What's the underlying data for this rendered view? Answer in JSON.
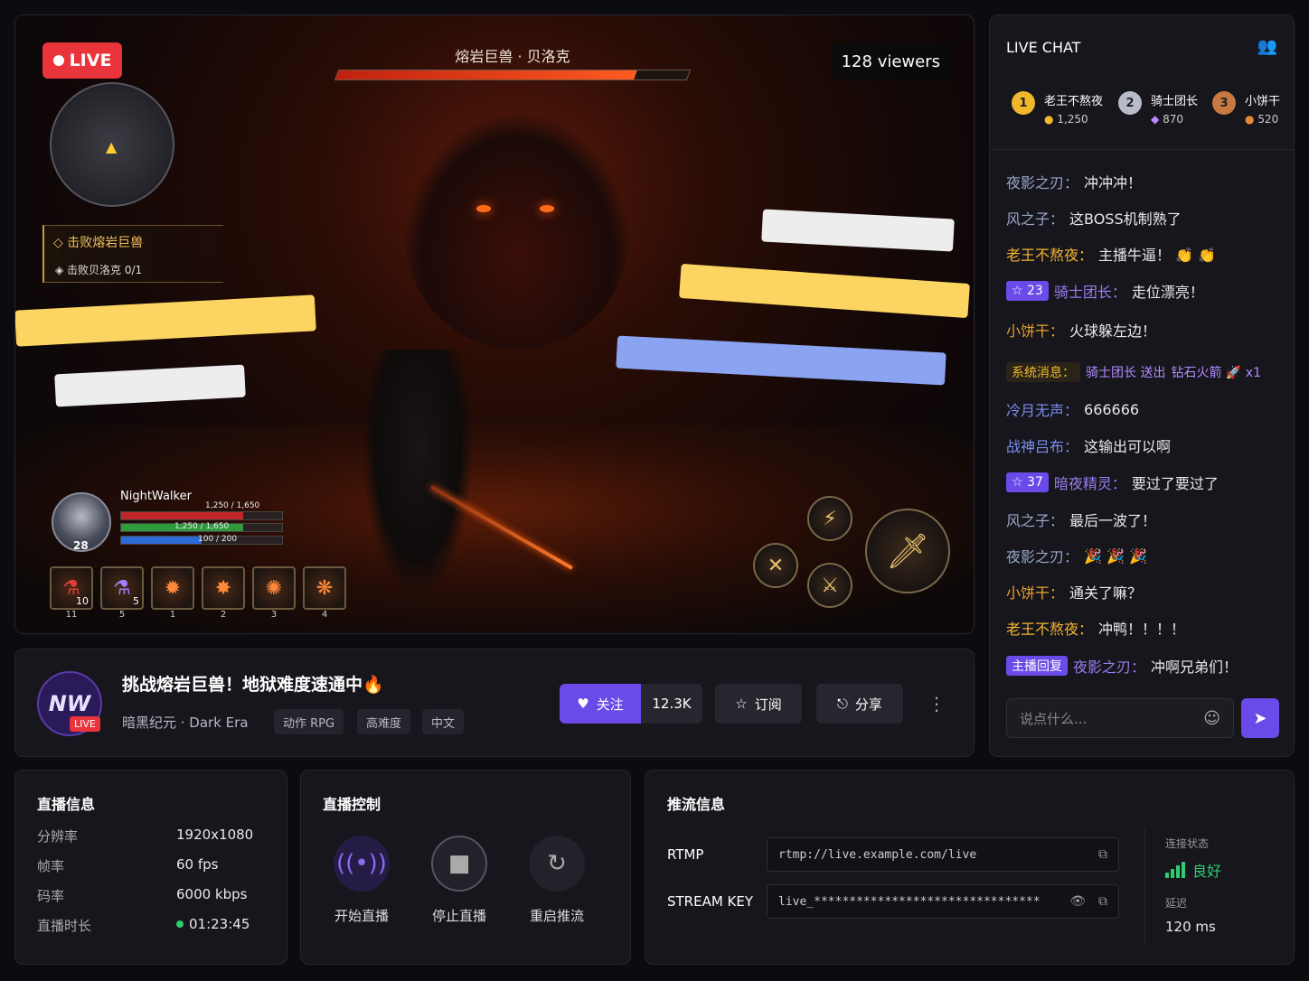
{
  "video": {
    "live_label": "LIVE",
    "viewers": "128 viewers",
    "boss_name": "熔岩巨兽 · 贝洛克",
    "boss_health_percent": 85,
    "quest": {
      "title": "击败熔岩巨兽",
      "sub": "击败贝洛克 0/1"
    },
    "player": {
      "name": "NightWalker",
      "level": "28",
      "hp_text": "1,250 / 1,650",
      "hp_percent": 76,
      "stamina_text": "1,250 / 1,650",
      "stamina_percent": 76,
      "mana_text": "100 / 200",
      "mana_percent": 50
    },
    "hotbar": [
      {
        "icon": "red-potion-icon",
        "glyph": "⚗",
        "count": "10",
        "key": "11"
      },
      {
        "icon": "purple-potion-icon",
        "glyph": "⚗",
        "count": "5",
        "key": "5"
      },
      {
        "icon": "fire-burst-skill-icon",
        "glyph": "✹",
        "count": "",
        "key": "1"
      },
      {
        "icon": "flame-slash-skill-icon",
        "glyph": "✸",
        "count": "",
        "key": "2"
      },
      {
        "icon": "meteor-skill-icon",
        "glyph": "✺",
        "count": "",
        "key": "3"
      },
      {
        "icon": "inferno-skill-icon",
        "glyph": "❋",
        "count": "",
        "key": "4"
      }
    ]
  },
  "info": {
    "logo_text": "NW",
    "logo_badge": "LIVE",
    "title": "挑战熔岩巨兽！地狱难度速通中🔥",
    "channel": "暗黑纪元 · Dark Era",
    "tags": [
      "动作 RPG",
      "高难度",
      "中文"
    ],
    "follow_label": "关注",
    "follow_count": "12.3K",
    "subscribe_label": "订阅",
    "share_label": "分享"
  },
  "chat": {
    "title": "LIVE CHAT",
    "top_fans": [
      {
        "rank": "1",
        "name": "老王不熬夜",
        "points": "1,250",
        "gem": "coin"
      },
      {
        "rank": "2",
        "name": "骑士团长",
        "points": "870",
        "gem": "gem"
      },
      {
        "rank": "3",
        "name": "小饼干",
        "points": "520",
        "gem": "coin"
      }
    ],
    "messages": [
      {
        "user": "夜影之刃：",
        "text": "冲冲冲！",
        "color": "#9aa6c8"
      },
      {
        "user": "风之子：",
        "text": "这BOSS机制熟了",
        "color": "#9aa6c8"
      },
      {
        "user": "老王不熬夜：",
        "text": "主播牛逼！ 👏 👏",
        "color": "#f5b531"
      },
      {
        "badge": "☆ 23",
        "user": "骑士团长：",
        "text": "走位漂亮！",
        "color": "#9b7cf0"
      },
      {
        "user": "小饼干：",
        "text": "火球躲左边！",
        "color": "#e8a030"
      },
      {
        "badge": "系统消息：",
        "user": "骑士团长 送出",
        "text": "钻石火箭 🚀 x1",
        "color": "#b48cff"
      },
      {
        "user": "冷月无声：",
        "text": "666666",
        "color": "#7a8cf0"
      },
      {
        "user": "战神吕布：",
        "text": "这输出可以啊",
        "color": "#7a8cf0"
      },
      {
        "badge": "☆ 37",
        "user": "暗夜精灵：",
        "text": "要过了要过了",
        "color": "#9b7cf0"
      },
      {
        "user": "风之子：",
        "text": "最后一波了！",
        "color": "#9aa6c8"
      },
      {
        "user": "夜影之刃：",
        "text": "🎉 🎉 🎉",
        "color": "#9aa6c8"
      },
      {
        "user": "小饼干：",
        "text": "通关了嘛？",
        "color": "#e8a030"
      },
      {
        "user": "老王不熬夜：",
        "text": "冲鸭！！！！",
        "color": "#f5b531"
      },
      {
        "badge": "主播回复",
        "user": "夜影之刃：",
        "text": "冲啊兄弟们！",
        "color": "#9b7cf0"
      }
    ],
    "input_placeholder": "说点什么..."
  },
  "stats": {
    "title": "直播信息",
    "rows": [
      {
        "label": "分辨率",
        "value": "1920x1080"
      },
      {
        "label": "帧率",
        "value": "60 fps"
      },
      {
        "label": "码率",
        "value": "6000 kbps"
      },
      {
        "label": "直播时长",
        "value": "01:23:45"
      }
    ]
  },
  "control": {
    "title": "直播控制",
    "buttons": [
      {
        "label": "开始直播",
        "icon": "broadcast-icon"
      },
      {
        "label": "停止直播",
        "icon": "stop-icon"
      },
      {
        "label": "重启推流",
        "icon": "restart-icon"
      }
    ]
  },
  "push": {
    "title": "推流信息",
    "rtmp_label": "RTMP",
    "rtmp_value": "rtmp://live.example.com/live",
    "key_label": "STREAM KEY",
    "key_value": "live_********************************",
    "conn_label": "连接状态",
    "conn_value": "良好",
    "latency_label": "延迟",
    "latency_value": "120 ms"
  },
  "colors": {
    "accent": "#6a4ae8",
    "live": "#e8343a",
    "good": "#2ecc71"
  }
}
